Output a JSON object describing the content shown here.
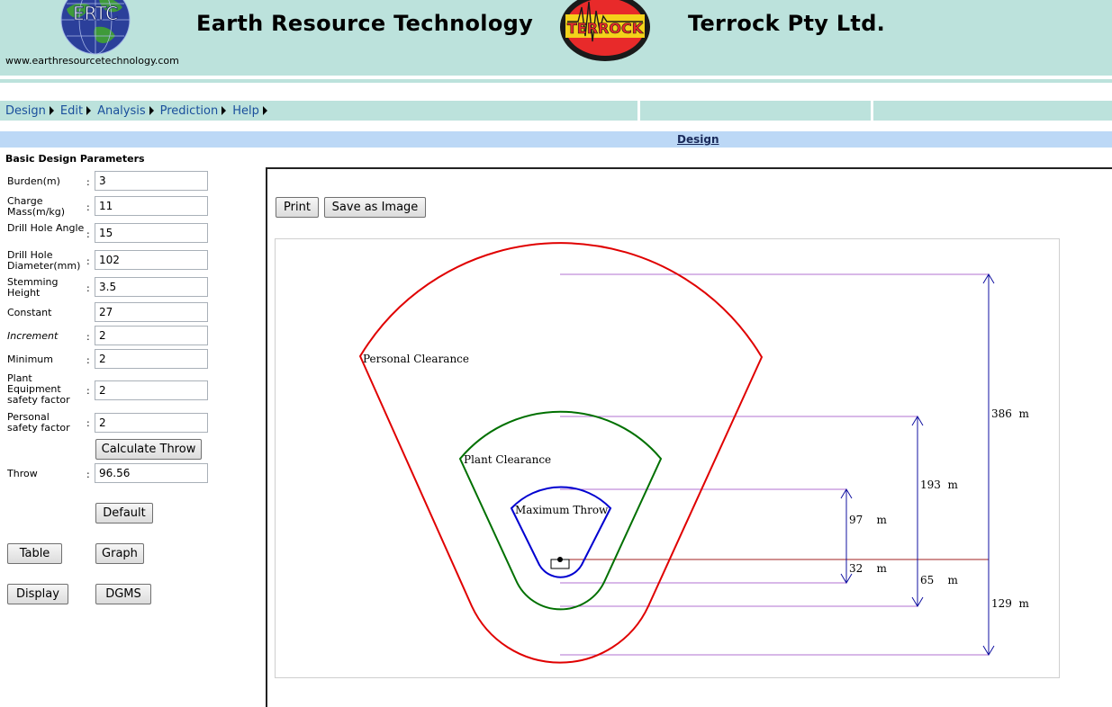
{
  "header": {
    "site_url": "www.earthresourcetechnology.com",
    "ert_title": "Earth Resource Technology",
    "ertc_logo_text": "ERTC",
    "terrock_logo_text": "TERROCK",
    "terrock_title": "Terrock Pty Ltd."
  },
  "menu": {
    "items": [
      {
        "label": "Design"
      },
      {
        "label": "Edit"
      },
      {
        "label": "Analysis"
      },
      {
        "label": "Prediction"
      },
      {
        "label": "Help"
      }
    ]
  },
  "section_title": "Design",
  "params": {
    "title": "Basic Design Parameters",
    "burden": {
      "label": "Burden(m)",
      "colon": ":",
      "value": "3"
    },
    "charge_mass": {
      "label": "Charge Mass(m/kg)",
      "colon": ":",
      "value": "11"
    },
    "drill_angle": {
      "label": "Drill Hole Angle",
      "colon": ":",
      "value": "15"
    },
    "drill_diameter": {
      "label": "Drill Hole Diameter(mm)",
      "colon": ":",
      "value": "102"
    },
    "stemming": {
      "label": "Stemming Height",
      "colon": ":",
      "value": "3.5"
    },
    "constant": {
      "label": "Constant",
      "value": "27"
    },
    "increment": {
      "label": "Increment",
      "colon": ":",
      "value": "2"
    },
    "minimum": {
      "label": "Minimum",
      "colon": ":",
      "value": "2"
    },
    "plant_factor": {
      "label": "Plant Equipment safety factor",
      "colon": ":",
      "value": "2"
    },
    "personal_factor": {
      "label": "Personal safety factor",
      "colon": ":",
      "value": "2"
    },
    "throw": {
      "label": "Throw",
      "colon": ":",
      "value": "96.56"
    }
  },
  "buttons": {
    "calculate": "Calculate Throw",
    "default": "Default",
    "table": "Table",
    "graph": "Graph",
    "display": "Display",
    "dgms": "DGMS",
    "print": "Print",
    "save_image": "Save as Image"
  },
  "diagram": {
    "personal_label": "Personal Clearance",
    "plant_label": "Plant Clearance",
    "throw_label": "Maximum Throw",
    "dim_386": "386  m",
    "dim_193": "193  m",
    "dim_97": "97    m",
    "dim_32": "32    m",
    "dim_65": "65    m",
    "dim_129": "129  m",
    "colors": {
      "personal": "#e00000",
      "plant": "#007000",
      "throw": "#0000d0",
      "dimension": "#1010a0",
      "guide": "#b070d0",
      "baseline": "#a02020"
    }
  }
}
